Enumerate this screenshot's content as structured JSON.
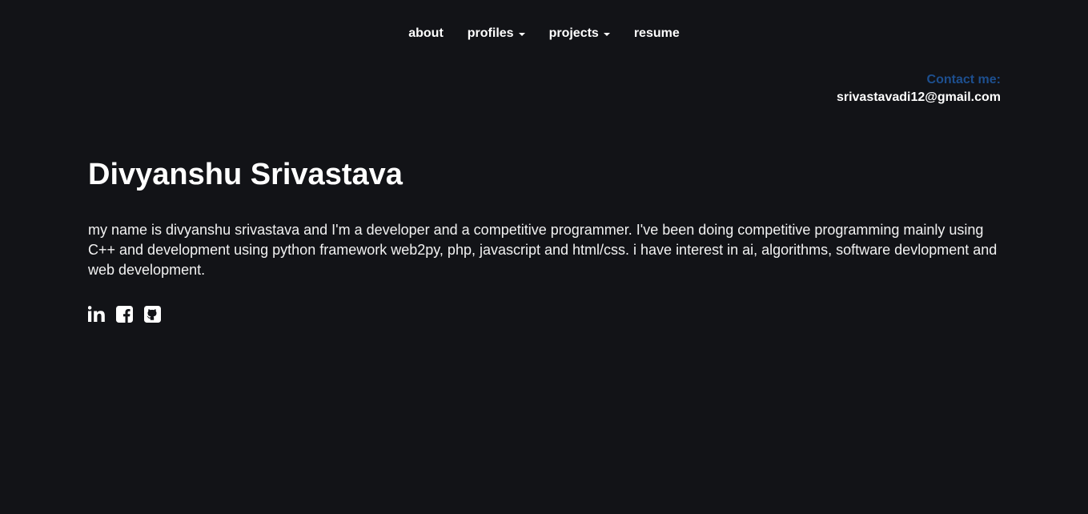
{
  "nav": {
    "items": [
      {
        "label": "about",
        "dropdown": false
      },
      {
        "label": "profiles",
        "dropdown": true
      },
      {
        "label": "projects",
        "dropdown": true
      },
      {
        "label": "resume",
        "dropdown": false
      }
    ]
  },
  "contact": {
    "label": "Contact me:",
    "email": "srivastavadi12@gmail.com"
  },
  "hero": {
    "name": "Divyanshu Srivastava",
    "bio": "my name is divyanshu srivastava and I'm a developer and a competitive programmer. I've been doing competitive programming mainly using C++ and development using python framework web2py, php, javascript and html/css. i have interest in ai, algorithms, software devlopment and web development."
  },
  "socials": [
    {
      "icon": "linkedin-icon"
    },
    {
      "icon": "facebook-icon"
    },
    {
      "icon": "github-icon"
    }
  ],
  "colors": {
    "background": "#121317",
    "text": "#ffffff",
    "accent": "#1d4f8f"
  }
}
